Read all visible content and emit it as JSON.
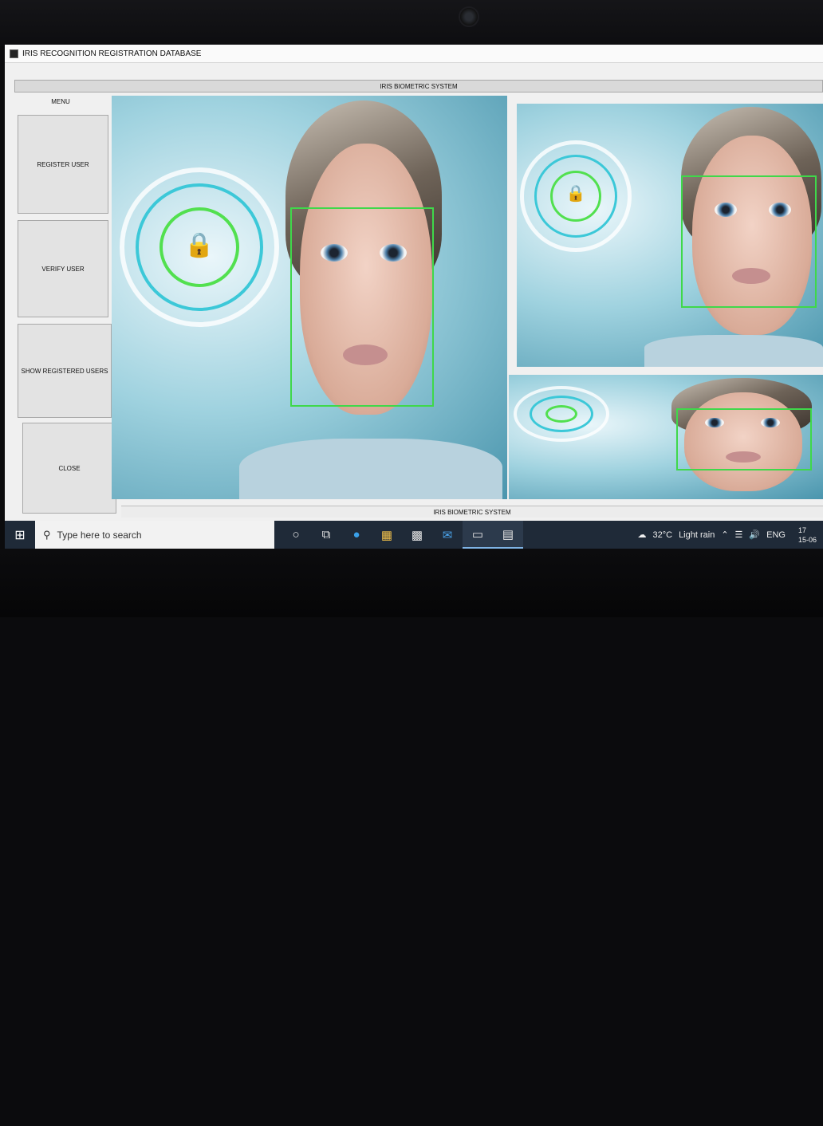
{
  "window": {
    "title": "IRIS RECOGNITION REGISTRATION DATABASE"
  },
  "header": {
    "banner": "IRIS BIOMETRIC SYSTEM"
  },
  "menu": {
    "label": "MENU",
    "buttons": [
      {
        "label": "REGISTER USER"
      },
      {
        "label": "VERIFY USER"
      },
      {
        "label": "SHOW REGISTERED USERS"
      },
      {
        "label": "CLOSE"
      }
    ]
  },
  "footer": {
    "label": "IRIS BIOMETRIC SYSTEM"
  },
  "taskbar": {
    "search_placeholder": "Type here to search",
    "icons": [
      "windows-start-icon",
      "search-icon",
      "cortana-icon",
      "task-view-icon",
      "edge-icon",
      "file-explorer-icon",
      "store-icon",
      "mail-icon",
      "app-icon",
      "window-app-icon"
    ],
    "weather_temp": "32°C",
    "weather_text": "Light rain",
    "language": "ENG",
    "clock_time": "17",
    "clock_date": "15-06"
  },
  "colors": {
    "bezel": "#0b0b0d",
    "window_bg": "#f0f0f0",
    "button_bg": "#e3e3e3",
    "scan_green": "#3fd84a",
    "image_teal": "#4a95ad",
    "taskbar": "#1f2a38"
  }
}
